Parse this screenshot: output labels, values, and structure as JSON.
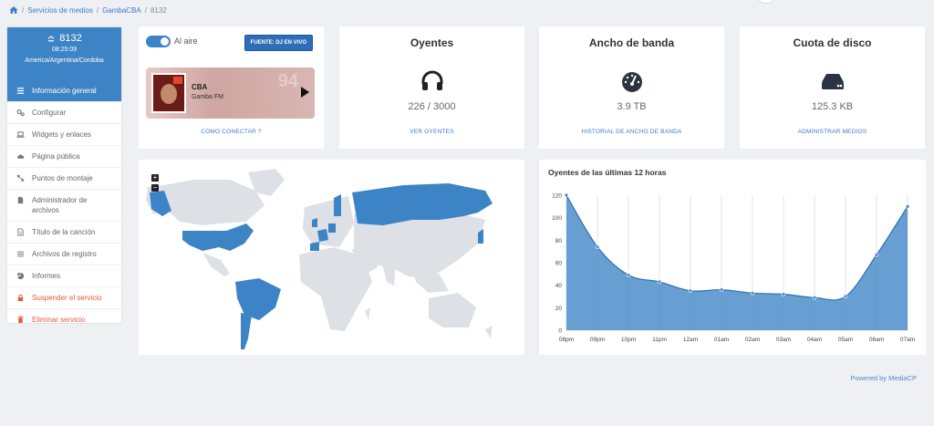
{
  "breadcrumb": {
    "items": [
      "Servicios de medios",
      "GambaCBA",
      "8132"
    ]
  },
  "sidebar": {
    "server_id": "8132",
    "time": "08:25:09",
    "timezone": "America/Argentina/Cordoba",
    "items": [
      {
        "label": "Información general",
        "icon": "list-icon"
      },
      {
        "label": "Configurar",
        "icon": "gears-icon"
      },
      {
        "label": "Widgets y enlaces",
        "icon": "laptop-icon"
      },
      {
        "label": "Página pública",
        "icon": "cloud-icon"
      },
      {
        "label": "Puntos de montaje",
        "icon": "sitemap-icon"
      },
      {
        "label": "Administrador de archivos",
        "icon": "file-icon"
      },
      {
        "label": "Título de la canción",
        "icon": "file-text-icon"
      },
      {
        "label": "Archivos de registro",
        "icon": "lines-icon"
      },
      {
        "label": "Informes",
        "icon": "pie-icon"
      },
      {
        "label": "Suspender el servicio",
        "icon": "lock-icon"
      },
      {
        "label": "Eliminar servicio",
        "icon": "trash-icon"
      }
    ]
  },
  "onair": {
    "toggle_label": "Al aire",
    "source_button": "FUENTE: DJ EN VIVO",
    "player_name": "CBA",
    "player_station": "Gamba FM",
    "connect_link": "COMO CONECTAR ?"
  },
  "stats": {
    "listeners": {
      "title": "Oyentes",
      "value": "226 / 3000",
      "link": "VER OYENTES",
      "icon": "headphones-icon"
    },
    "bandwidth": {
      "title": "Ancho de banda",
      "value": "3.9 TB",
      "link": "HISTORIAL DE ANCHO DE BANDA",
      "icon": "gauge-icon"
    },
    "disk": {
      "title": "Cuota de disco",
      "value": "125.3 KB",
      "link": "ADMINISTRAR MEDIOS",
      "icon": "hdd-icon"
    }
  },
  "map": {
    "zoom_in": "+",
    "zoom_out": "−",
    "highlight_color": "#3d84c6",
    "land_color": "#dde0e5"
  },
  "chart_data": {
    "type": "area",
    "title": "Oyentes de las últimas 12 horas",
    "categories": [
      "08pm",
      "09pm",
      "10pm",
      "11pm",
      "12am",
      "01am",
      "02am",
      "03am",
      "04am",
      "05am",
      "06am",
      "07am"
    ],
    "series": [
      {
        "values": [
          120,
          74,
          49,
          43,
          35,
          36,
          33,
          32,
          29,
          30,
          67,
          110
        ]
      }
    ],
    "ylim": [
      0,
      120
    ],
    "yticks": [
      0,
      20,
      40,
      60,
      80,
      100,
      120
    ],
    "color": "#3d84c6"
  },
  "footer": {
    "powered": "Powered by MediaCP"
  }
}
